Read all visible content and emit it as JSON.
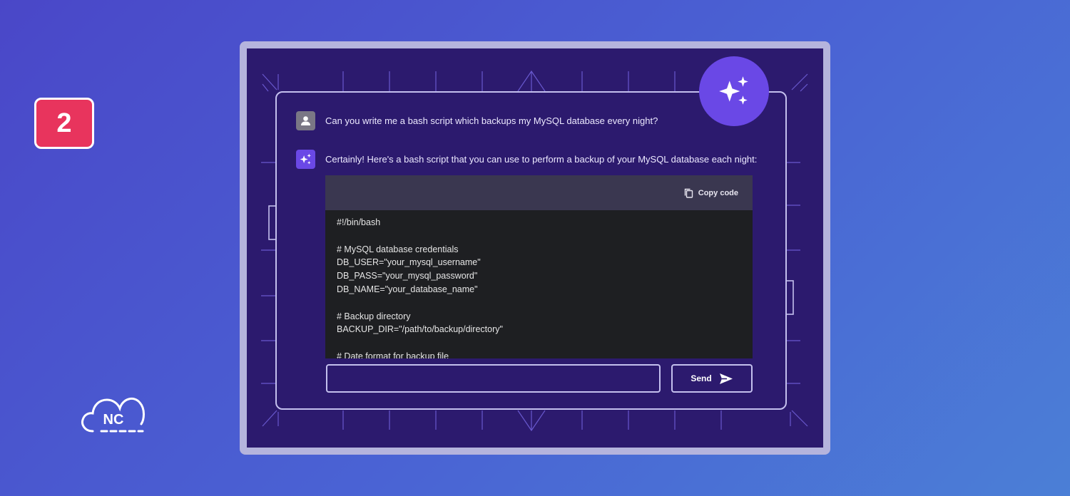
{
  "badge": {
    "number": "2"
  },
  "logo": {
    "text": "NC"
  },
  "chat": {
    "user_message": "Can you write me a bash script which backups my MySQL database every night?",
    "ai_message": "Certainly! Here's a bash script that you can use to perform a backup of your MySQL database each night:",
    "copy_label": "Copy code",
    "code_lines": [
      "#!/bin/bash",
      "",
      "# MySQL database credentials",
      "DB_USER=\"your_mysql_username\"",
      "DB_PASS=\"your_mysql_password\"",
      "DB_NAME=\"your_database_name\"",
      "",
      "# Backup directory",
      "BACKUP_DIR=\"/path/to/backup/directory\"",
      "",
      "# Date format for backup file"
    ],
    "input_value": "",
    "input_placeholder": "",
    "send_label": "Send"
  },
  "colors": {
    "badge": "#e8345d",
    "panel_bg": "#2c1a6e",
    "accent": "#6a48e6",
    "code_bg": "#1e1f22",
    "code_header": "#3a3750"
  },
  "icons": {
    "user": "user-icon",
    "ai": "sparkle-icon",
    "copy": "copy-icon",
    "send": "send-arrow-icon",
    "logo": "cloud-icon"
  }
}
